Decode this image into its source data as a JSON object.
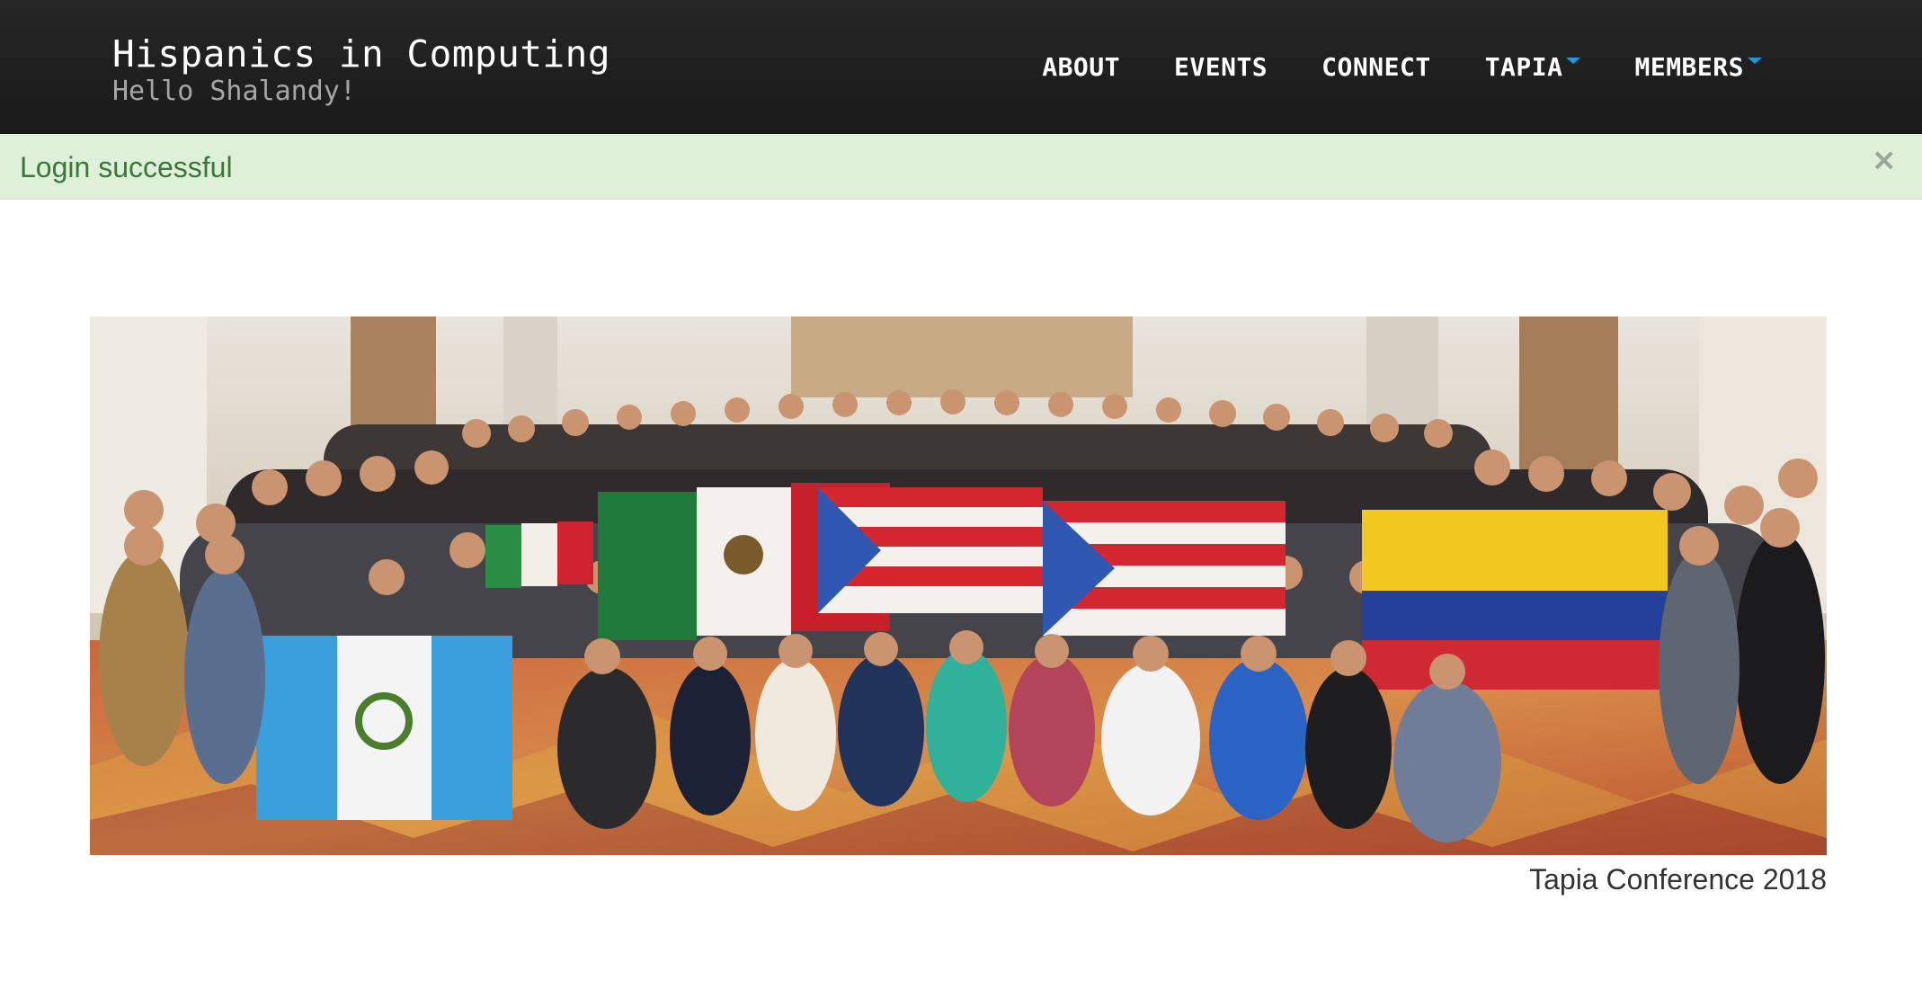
{
  "header": {
    "title": "Hispanics in Computing",
    "greeting": "Hello Shalandy!",
    "nav": [
      {
        "label": "ABOUT"
      },
      {
        "label": "EVENTS"
      },
      {
        "label": "CONNECT"
      },
      {
        "label": "TAPIA",
        "has_dropdown": true
      },
      {
        "label": "MEMBERS",
        "has_dropdown": true
      }
    ],
    "dropdown_caret_color": "#1a9be0"
  },
  "alert": {
    "message": "Login successful",
    "close_icon": "close-icon",
    "close_glyph": "×",
    "colors": {
      "background": "#dff0d8",
      "text": "#3c763d"
    }
  },
  "main": {
    "photo_caption": "Tapia Conference 2018"
  }
}
